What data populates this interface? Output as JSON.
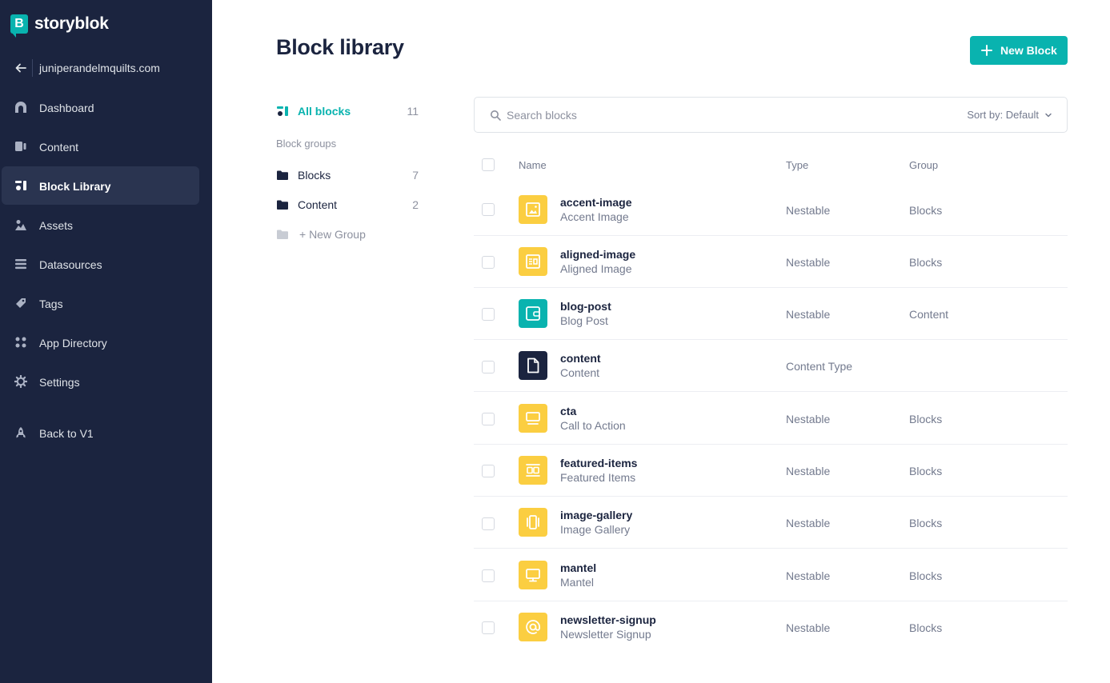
{
  "brand": {
    "name": "storyblok",
    "logo_letter": "B"
  },
  "space": {
    "name": "juniperandelmquilts.com"
  },
  "sidebar": {
    "items": [
      {
        "label": "Dashboard",
        "icon": "dashboard-icon"
      },
      {
        "label": "Content",
        "icon": "content-icon"
      },
      {
        "label": "Block Library",
        "icon": "block-library-icon",
        "active": true
      },
      {
        "label": "Assets",
        "icon": "assets-icon"
      },
      {
        "label": "Datasources",
        "icon": "datasources-icon"
      },
      {
        "label": "Tags",
        "icon": "tags-icon"
      },
      {
        "label": "App Directory",
        "icon": "app-directory-icon"
      },
      {
        "label": "Settings",
        "icon": "gear-icon"
      },
      {
        "label": "Back to V1",
        "icon": "rocket-icon"
      }
    ]
  },
  "header": {
    "title": "Block library",
    "new_block_label": "New Block"
  },
  "groups": {
    "all_label": "All blocks",
    "all_count": "11",
    "section_label": "Block groups",
    "items": [
      {
        "label": "Blocks",
        "count": "7"
      },
      {
        "label": "Content",
        "count": "2"
      }
    ],
    "new_group_label": "+ New Group"
  },
  "search": {
    "placeholder": "Search blocks",
    "sort_label": "Sort by: Default"
  },
  "table": {
    "columns": {
      "name": "Name",
      "type": "Type",
      "group": "Group"
    },
    "rows": [
      {
        "name": "accent-image",
        "display": "Accent Image",
        "type": "Nestable",
        "group": "Blocks",
        "icon": "image-icon",
        "color": "#fbce41"
      },
      {
        "name": "aligned-image",
        "display": "Aligned Image",
        "type": "Nestable",
        "group": "Blocks",
        "icon": "aligned-image-icon",
        "color": "#fbce41"
      },
      {
        "name": "blog-post",
        "display": "Blog Post",
        "type": "Nestable",
        "group": "Content",
        "icon": "wallet-icon",
        "color": "#09b3af"
      },
      {
        "name": "content",
        "display": "Content",
        "type": "Content Type",
        "group": "",
        "icon": "document-icon",
        "color": "#1b243f"
      },
      {
        "name": "cta",
        "display": "Call to Action",
        "type": "Nestable",
        "group": "Blocks",
        "icon": "cta-icon",
        "color": "#fbce41"
      },
      {
        "name": "featured-items",
        "display": "Featured Items",
        "type": "Nestable",
        "group": "Blocks",
        "icon": "columns-icon",
        "color": "#fbce41"
      },
      {
        "name": "image-gallery",
        "display": "Image Gallery",
        "type": "Nestable",
        "group": "Blocks",
        "icon": "gallery-icon",
        "color": "#fbce41"
      },
      {
        "name": "mantel",
        "display": "Mantel",
        "type": "Nestable",
        "group": "Blocks",
        "icon": "monitor-icon",
        "color": "#fbce41"
      },
      {
        "name": "newsletter-signup",
        "display": "Newsletter Signup",
        "type": "Nestable",
        "group": "Blocks",
        "icon": "at-icon",
        "color": "#fbce41"
      }
    ]
  },
  "colors": {
    "sidebar_bg": "#1b243f",
    "accent": "#09b3af",
    "block_yellow": "#fbce41"
  }
}
